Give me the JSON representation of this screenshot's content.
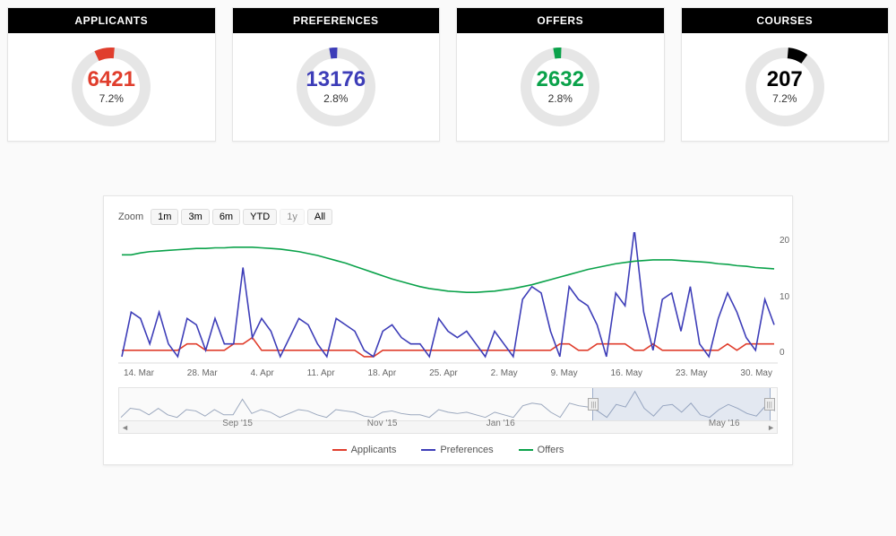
{
  "stats": [
    {
      "key": "applicants",
      "label": "APPLICANTS",
      "value": "6421",
      "pct": "7.2%",
      "color": "#e03e2d",
      "arc_offset_deg": -25,
      "arc_sweep_deg": 30
    },
    {
      "key": "preferences",
      "label": "PREFERENCES",
      "value": "13176",
      "pct": "2.8%",
      "color": "#3d3db8",
      "arc_offset_deg": -10,
      "arc_sweep_deg": 12
    },
    {
      "key": "offers",
      "label": "OFFERS",
      "value": "2632",
      "pct": "2.8%",
      "color": "#0aa24a",
      "arc_offset_deg": -10,
      "arc_sweep_deg": 12
    },
    {
      "key": "courses",
      "label": "COURSES",
      "value": "207",
      "pct": "7.2%",
      "color": "#000000",
      "arc_offset_deg": 5,
      "arc_sweep_deg": 30
    }
  ],
  "zoom": {
    "label": "Zoom",
    "buttons": [
      {
        "key": "1m",
        "label": "1m",
        "enabled": true
      },
      {
        "key": "3m",
        "label": "3m",
        "enabled": true
      },
      {
        "key": "6m",
        "label": "6m",
        "enabled": true
      },
      {
        "key": "ytd",
        "label": "YTD",
        "enabled": true
      },
      {
        "key": "1y",
        "label": "1y",
        "enabled": false
      },
      {
        "key": "all",
        "label": "All",
        "enabled": true
      }
    ]
  },
  "chart_data": {
    "type": "line",
    "ylim": [
      0,
      20
    ],
    "y_ticks": [
      20,
      10,
      0
    ],
    "x_categories": [
      "14. Mar",
      "28. Mar",
      "4. Apr",
      "11. Apr",
      "18. Apr",
      "25. Apr",
      "2. May",
      "9. May",
      "16. May",
      "23. May",
      "30. May"
    ],
    "series": [
      {
        "name": "Applicants",
        "color": "#e03e2d",
        "values": [
          2,
          2,
          2,
          2,
          2,
          2,
          2,
          3,
          3,
          2,
          2,
          2,
          3,
          3,
          4,
          2,
          2,
          2,
          2,
          2,
          2,
          2,
          2,
          2,
          2,
          2,
          1,
          1,
          2,
          2,
          2,
          2,
          2,
          2,
          2,
          2,
          2,
          2,
          2,
          2,
          2,
          2,
          2,
          2,
          2,
          2,
          2,
          3,
          3,
          2,
          2,
          3,
          3,
          3,
          3,
          2,
          2,
          3,
          2,
          2,
          2,
          2,
          2,
          2,
          2,
          3,
          2,
          3,
          3,
          3,
          3
        ]
      },
      {
        "name": "Preferences",
        "color": "#3d3db8",
        "values": [
          1,
          8,
          7,
          3,
          8,
          3,
          1,
          7,
          6,
          2,
          7,
          3,
          3,
          15,
          4,
          7,
          5,
          1,
          4,
          7,
          6,
          3,
          1,
          7,
          6,
          5,
          2,
          1,
          5,
          6,
          4,
          3,
          3,
          1,
          7,
          5,
          4,
          5,
          3,
          1,
          5,
          3,
          1,
          10,
          12,
          11,
          5,
          1,
          12,
          10,
          9,
          6,
          1,
          11,
          9,
          21,
          8,
          2,
          10,
          11,
          5,
          12,
          3,
          1,
          7,
          11,
          8,
          4,
          2,
          10,
          6
        ]
      },
      {
        "name": "Offers",
        "color": "#0aa24a",
        "values": [
          17,
          17,
          17.3,
          17.5,
          17.6,
          17.7,
          17.8,
          17.9,
          18,
          18,
          18.1,
          18.1,
          18.2,
          18.2,
          18.2,
          18.1,
          18,
          17.9,
          17.7,
          17.5,
          17.2,
          16.9,
          16.5,
          16.1,
          15.7,
          15.2,
          14.7,
          14.2,
          13.7,
          13.2,
          12.8,
          12.4,
          12,
          11.7,
          11.5,
          11.3,
          11.2,
          11.1,
          11.1,
          11.2,
          11.3,
          11.5,
          11.7,
          12,
          12.3,
          12.7,
          13.1,
          13.5,
          13.9,
          14.3,
          14.7,
          15,
          15.3,
          15.6,
          15.8,
          16,
          16.1,
          16.2,
          16.2,
          16.2,
          16.1,
          16,
          15.9,
          15.8,
          15.6,
          15.5,
          15.3,
          15.2,
          15,
          14.9,
          14.8
        ]
      }
    ],
    "navigator": {
      "ticks": [
        {
          "label": "Sep '15",
          "pos_pct": 18
        },
        {
          "label": "Nov '15",
          "pos_pct": 40
        },
        {
          "label": "Jan '16",
          "pos_pct": 58
        },
        {
          "label": "May '16",
          "pos_pct": 92
        }
      ],
      "window": {
        "left_pct": 72,
        "right_pct": 99
      }
    }
  },
  "legend": [
    {
      "label": "Applicants",
      "color": "#e03e2d"
    },
    {
      "label": "Preferences",
      "color": "#3d3db8"
    },
    {
      "label": "Offers",
      "color": "#0aa24a"
    }
  ]
}
